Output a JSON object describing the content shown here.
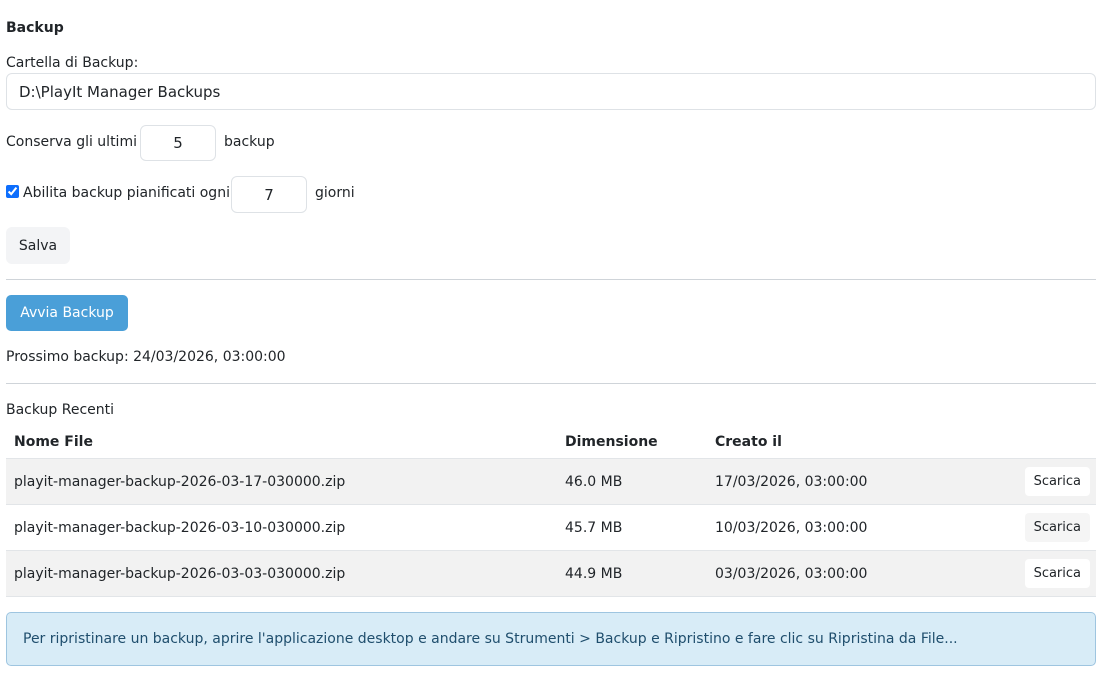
{
  "section_title": "Backup",
  "folder": {
    "label": "Cartella di Backup:",
    "value": "D:\\PlayIt Manager Backups"
  },
  "retention": {
    "prefix": "Conserva gli ultimi",
    "value": "5",
    "suffix": "backup"
  },
  "schedule": {
    "checked": true,
    "label": "Abilita backup pianificati ogni",
    "value": "7",
    "suffix": "giorni"
  },
  "save_label": "Salva",
  "start_backup_label": "Avvia Backup",
  "next_backup": "Prossimo backup: 24/03/2026, 03:00:00",
  "recent": {
    "title": "Backup Recenti",
    "columns": {
      "name": "Nome File",
      "size": "Dimensione",
      "created": "Creato il"
    },
    "rows": [
      {
        "name": "playit-manager-backup-2026-03-17-030000.zip",
        "size": "46.0 MB",
        "created": "17/03/2026, 03:00:00",
        "action": "Scarica"
      },
      {
        "name": "playit-manager-backup-2026-03-10-030000.zip",
        "size": "45.7 MB",
        "created": "10/03/2026, 03:00:00",
        "action": "Scarica"
      },
      {
        "name": "playit-manager-backup-2026-03-03-030000.zip",
        "size": "44.9 MB",
        "created": "03/03/2026, 03:00:00",
        "action": "Scarica"
      }
    ]
  },
  "info_text": "Per ripristinare un backup, aprire l'applicazione desktop e andare su Strumenti > Backup e Ripristino e fare clic su Ripristina da File...",
  "colors": {
    "primary_button": "#4a9fd8",
    "info_background": "#d8ecf7",
    "info_border": "#9ec5e0"
  }
}
